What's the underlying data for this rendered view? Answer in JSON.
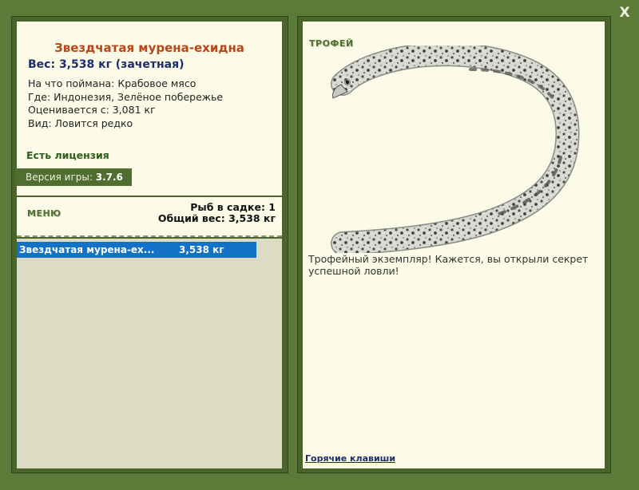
{
  "fish": {
    "title": "Звездчатая мурена-ехидна",
    "weight_line": "Вес: 3,538 кг (зачетная)",
    "details": [
      "На что поймана: Крабовое мясо",
      "Где: Индонезия, Зелёное побережье",
      "Оценивается с: 3,081 кг",
      "Вид: Ловится редко"
    ]
  },
  "license": "Есть лицензия",
  "version": {
    "label": "Версия игры: ",
    "value": "3.7.6"
  },
  "menu": {
    "label": "МЕНЮ"
  },
  "stats": {
    "fish_count": "Рыб в садке: 1",
    "total_weight": "Общий вес: 3,538 кг"
  },
  "catch_list": [
    {
      "name": "Звездчатая мурена-ех...",
      "weight": "3,538 кг"
    }
  ],
  "trophy": {
    "label": "ТРОФЕЙ",
    "description": "Трофейный экземпляр! Кажется, вы открыли секрет успешной ловли!"
  },
  "hotkeys": "Горячие клавиши",
  "close": "X",
  "icons": {
    "close": "close-icon",
    "fish_image": "moray-eel-image"
  }
}
